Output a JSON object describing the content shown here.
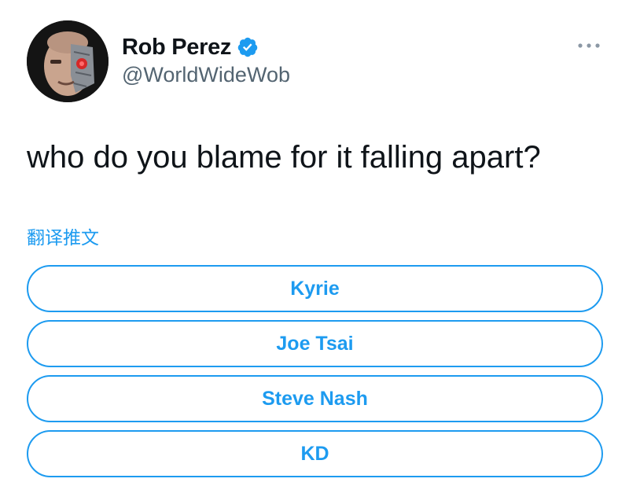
{
  "author": {
    "display_name": "Rob Perez",
    "handle": "@WorldWideWob",
    "verified": true,
    "avatar_icon": "cyborg-face-avatar"
  },
  "menu": {
    "icon": "more-options-icon"
  },
  "tweet": {
    "text": "who do you blame for it falling apart?",
    "translate_label": "翻译推文"
  },
  "poll": {
    "options": [
      {
        "label": "Kyrie"
      },
      {
        "label": "Joe Tsai"
      },
      {
        "label": "Steve Nash"
      },
      {
        "label": "KD"
      }
    ]
  },
  "colors": {
    "accent": "#1d9bf0",
    "text_primary": "#0f1419",
    "text_secondary": "#536471"
  }
}
